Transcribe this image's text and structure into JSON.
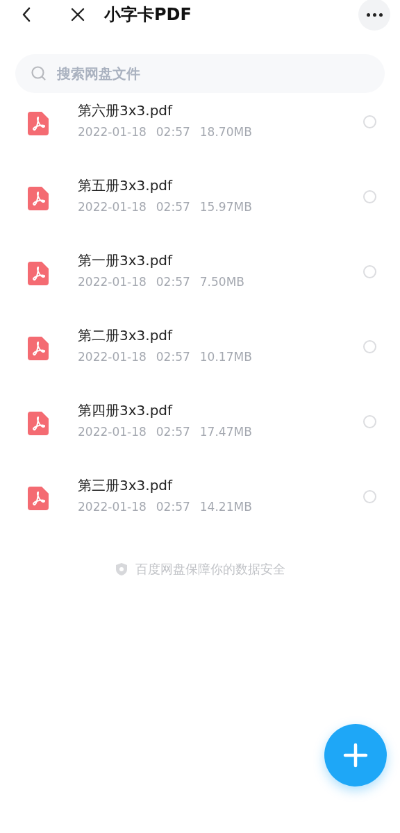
{
  "header": {
    "title": "小字卡PDF"
  },
  "search": {
    "placeholder": "搜索网盘文件"
  },
  "files": [
    {
      "name": "第六册3x3.pdf",
      "date": "2022-01-18",
      "time": "02:57",
      "size": "18.70MB",
      "selected": false
    },
    {
      "name": "第五册3x3.pdf",
      "date": "2022-01-18",
      "time": "02:57",
      "size": "15.97MB",
      "selected": false
    },
    {
      "name": "第一册3x3.pdf",
      "date": "2022-01-18",
      "time": "02:57",
      "size": "7.50MB",
      "selected": false
    },
    {
      "name": "第二册3x3.pdf",
      "date": "2022-01-18",
      "time": "02:57",
      "size": "10.17MB",
      "selected": false
    },
    {
      "name": "第四册3x3.pdf",
      "date": "2022-01-18",
      "time": "02:57",
      "size": "17.47MB",
      "selected": false
    },
    {
      "name": "第三册3x3.pdf",
      "date": "2022-01-18",
      "time": "02:57",
      "size": "14.21MB",
      "selected": false
    }
  ],
  "footer": {
    "text": "百度网盘保障你的数据安全"
  }
}
